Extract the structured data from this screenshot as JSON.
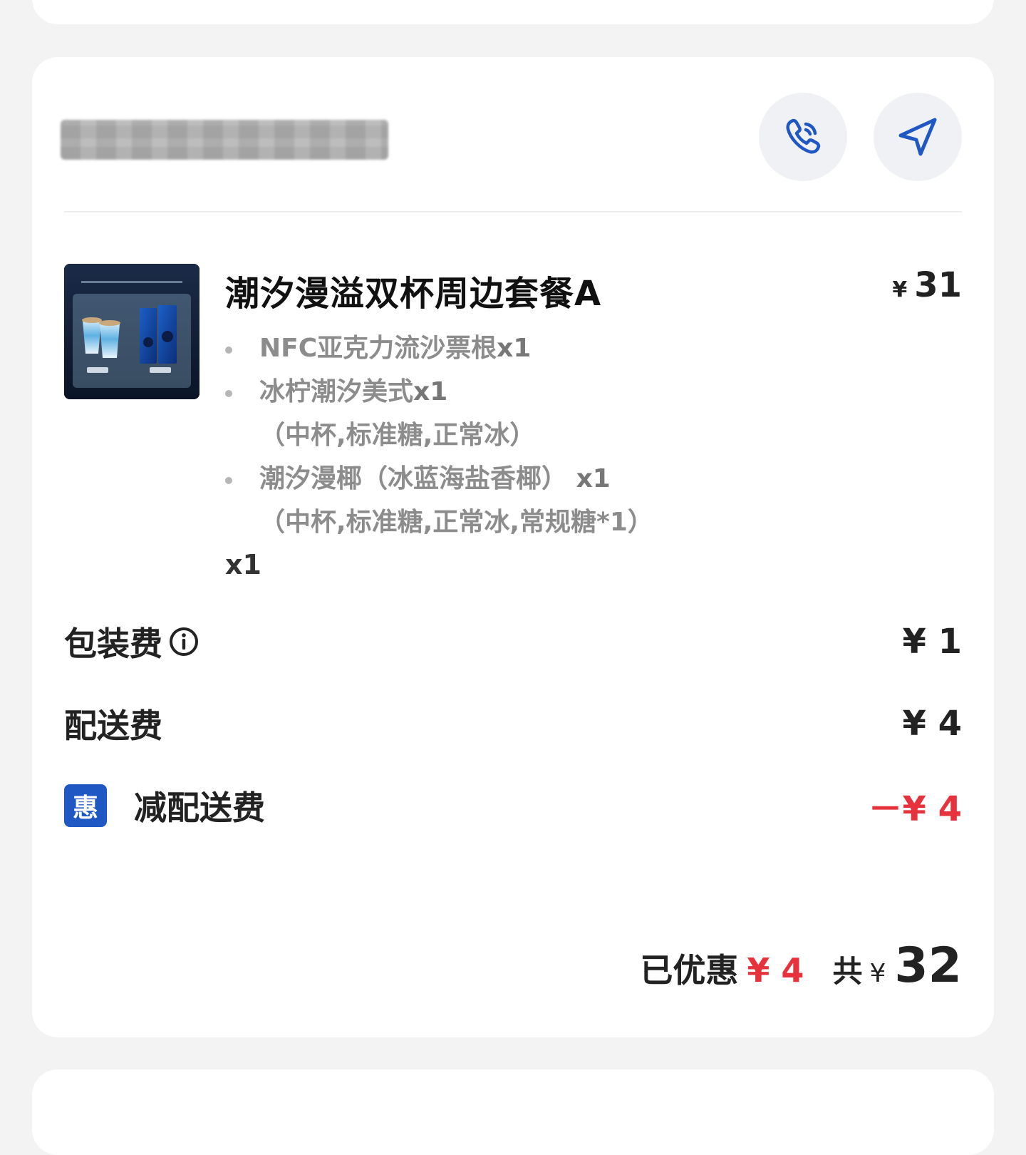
{
  "shop": {
    "name": "████████"
  },
  "actions": {
    "call": "phone-icon",
    "navigate": "navigation-arrow-icon"
  },
  "product": {
    "image_title": "潮汐漫溢双杯周边套餐A",
    "name": "潮汐漫溢双杯周边套餐A",
    "price": "31",
    "currency": "¥",
    "items": [
      {
        "name": "NFC亚克力流沙票根",
        "qty": "x1",
        "spec": ""
      },
      {
        "name": "冰柠潮汐美式",
        "qty": "x1",
        "spec": "（中杯,标准糖,正常冰）"
      },
      {
        "name": "潮汐漫椰（冰蓝海盐香椰）",
        "qty": "x1",
        "spec": "（中杯,标准糖,正常冰,常规糖*1）"
      }
    ],
    "quantity": "x1"
  },
  "fees": {
    "packaging": {
      "label": "包装费",
      "value": "¥ 1"
    },
    "delivery": {
      "label": "配送费",
      "value": "¥ 4"
    },
    "discount": {
      "badge": "惠",
      "label": "减配送费",
      "value": "－¥ 4"
    }
  },
  "summary": {
    "saved_label": "已优惠",
    "saved_value": "¥ 4",
    "total_label": "共",
    "total_currency": "¥",
    "total_value": "32"
  },
  "colors": {
    "accent_blue": "#1f57c3",
    "discount_red": "#e5323c",
    "background": "#f3f3f3",
    "card": "#ffffff"
  }
}
